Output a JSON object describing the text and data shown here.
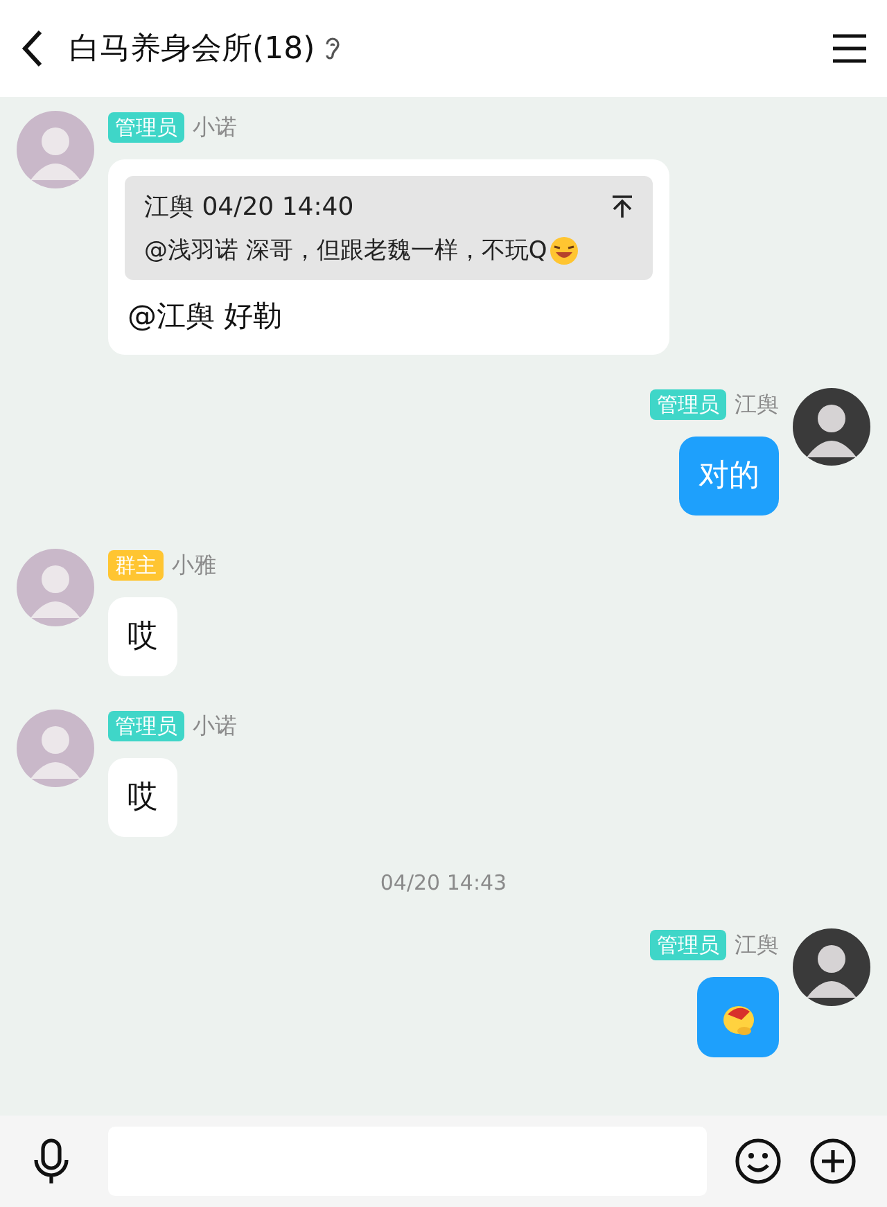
{
  "header": {
    "title": "白马养身会所(18)"
  },
  "messages": [
    {
      "kind": "quote",
      "outgoing": false,
      "badge": {
        "label": "管理员",
        "color": "#3fd6c8"
      },
      "name": "小诺",
      "quote": {
        "header": "江舆 04/20 14:40",
        "text": "@浅羽诺 深哥，但跟老魏一样，不玩Q"
      },
      "text": "@江舆 好勒"
    },
    {
      "kind": "text",
      "outgoing": true,
      "badge": {
        "label": "管理员",
        "color": "#3fd6c8"
      },
      "name": "江舆",
      "text": "对的"
    },
    {
      "kind": "text",
      "outgoing": false,
      "badge": {
        "label": "群主",
        "color": "#ffc531"
      },
      "name": "小雅",
      "text": "哎"
    },
    {
      "kind": "text",
      "outgoing": false,
      "badge": {
        "label": "管理员",
        "color": "#3fd6c8"
      },
      "name": "小诺",
      "text": "哎"
    },
    {
      "kind": "time",
      "text": "04/20 14:43"
    },
    {
      "kind": "sticker",
      "outgoing": true,
      "badge": {
        "label": "管理员",
        "color": "#3fd6c8"
      },
      "name": "江舆"
    }
  ]
}
